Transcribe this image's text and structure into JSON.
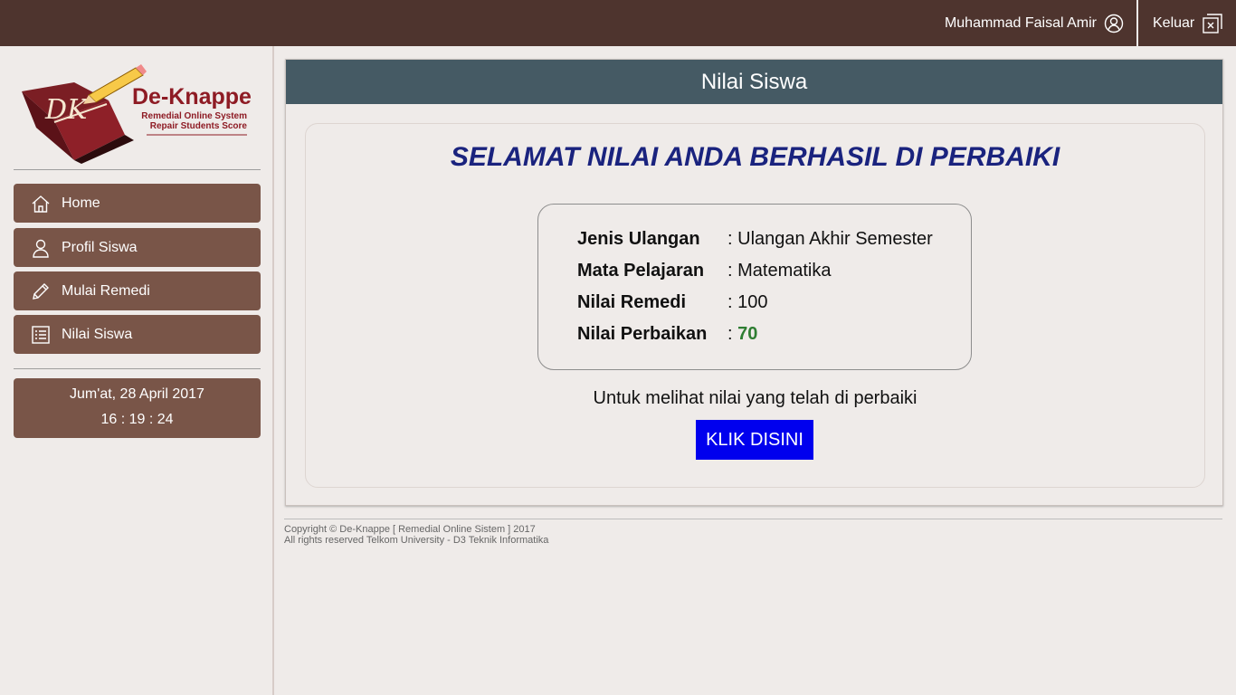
{
  "header": {
    "user_name": "Muhammad Faisal Amir",
    "logout_label": "Keluar"
  },
  "logo": {
    "brand": "De-Knappe",
    "tagline_1": "Remedial Online System",
    "tagline_2": "Repair Students Score",
    "monogram": "DK"
  },
  "sidebar": {
    "items": [
      {
        "label": "Home",
        "icon": "home-icon"
      },
      {
        "label": "Profil Siswa",
        "icon": "user-icon"
      },
      {
        "label": "Mulai Remedi",
        "icon": "pencil-icon"
      },
      {
        "label": "Nilai Siswa",
        "icon": "list-icon"
      }
    ],
    "date": "Jum'at, 28 April 2017",
    "time": "16 : 19 : 24"
  },
  "main": {
    "title": "Nilai Siswa",
    "success_message": "SELAMAT NILAI ANDA BERHASIL DI PERBAIKI",
    "info": [
      {
        "label": "Jenis Ulangan",
        "value": "Ulangan Akhir Semester"
      },
      {
        "label": "Mata Pelajaran",
        "value": "Matematika"
      },
      {
        "label": "Nilai Remedi",
        "value": "100"
      },
      {
        "label": "Nilai Perbaikan",
        "value": "70"
      }
    ],
    "note": "Untuk melihat nilai yang telah di perbaiki",
    "button_label": "KLIK DISINI"
  },
  "footer": {
    "line1": "Copyright © De-Knappe [ Remedial Online Sistem ] 2017",
    "line2": "All rights reserved Telkom University - D3 Teknik Informatika"
  },
  "colors": {
    "topbar": "#4e342e",
    "nav": "#795548",
    "panel_head": "#455a64",
    "success": "#1a237e",
    "score": "#2e7d32",
    "button": "#0000ee"
  }
}
